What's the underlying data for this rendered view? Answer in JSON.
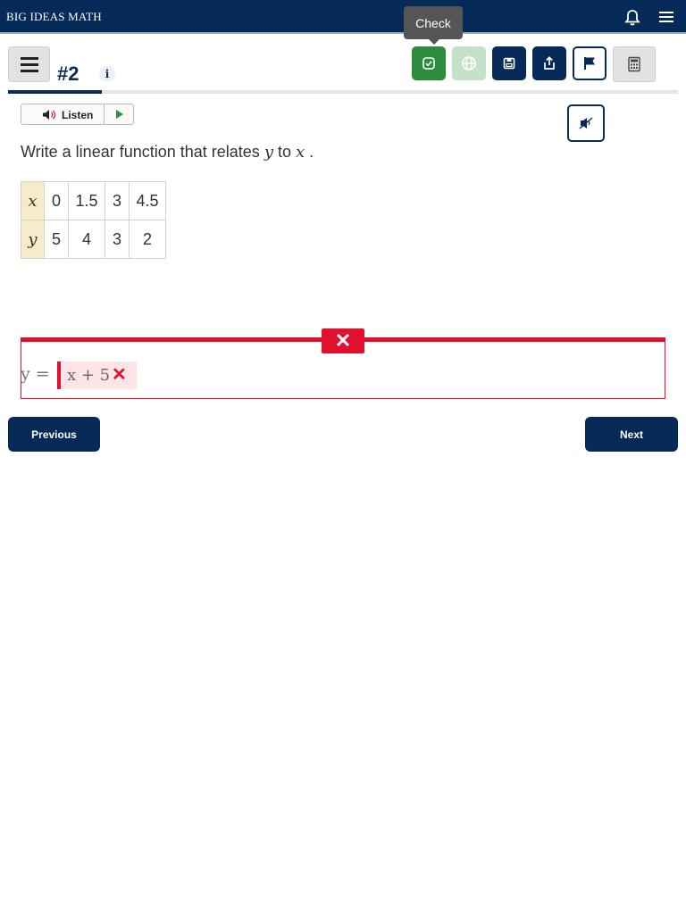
{
  "app": {
    "brand": "BIG IDEAS MATH"
  },
  "tooltip": {
    "text": "Check"
  },
  "question": {
    "number": "#2",
    "info_label": "i",
    "listen_label": "Listen",
    "prompt_before": "Write a linear function that relates ",
    "var_y": "y",
    "prompt_middle": " to ",
    "var_x": "x",
    "prompt_after": " ."
  },
  "progress": {
    "fraction": 0.14
  },
  "table": {
    "x_label": "x",
    "y_label": "y",
    "x_values": [
      "0",
      "1.5",
      "3",
      "4.5"
    ],
    "y_values": [
      "5",
      "4",
      "3",
      "2"
    ]
  },
  "answer": {
    "lhs": "y =",
    "value": "x + 5",
    "status": "incorrect",
    "wrong_mark": "✕"
  },
  "nav": {
    "previous": "Previous",
    "next": "Next"
  },
  "icons": {
    "check": "check-icon",
    "globe": "globe-icon",
    "save": "save-icon",
    "share": "share-icon",
    "flag": "flag-icon",
    "calculator": "calculator-icon",
    "bell": "bell-icon",
    "menu": "menu-icon",
    "speaker": "speaker-icon",
    "play": "play-icon",
    "mute": "mute-icon"
  },
  "colors": {
    "navy": "#062a57",
    "check_green": "#2e8b3e",
    "disabled_green": "#c6e1c9",
    "error_red": "#e0102f",
    "table_header": "#f7ecc9"
  }
}
